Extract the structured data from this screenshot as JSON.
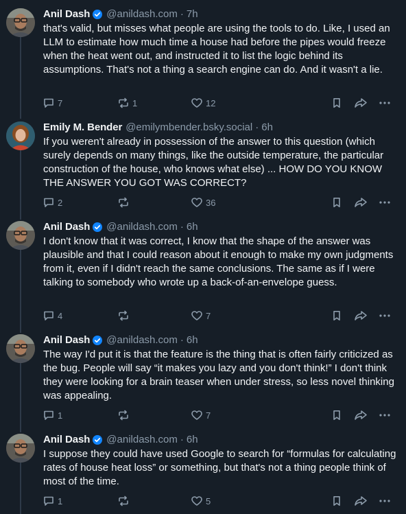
{
  "posts": [
    {
      "display_name": "Anil Dash",
      "verified": true,
      "handle": "@anildash.com",
      "separator": "·",
      "time": "7h",
      "text": "that's valid, but misses what people are using the tools to do. Like, I used an LLM to estimate how much time a house had before the pipes would freeze when the heat went out, and instructed it to list the logic behind its assumptions. That's not a thing a search engine can do. And it wasn't a lie.",
      "replies": "7",
      "reposts": "1",
      "likes": "12"
    },
    {
      "display_name": "Emily M. Bender",
      "verified": false,
      "handle": "@emilymbender.bsky.social",
      "separator": "·",
      "time": "6h",
      "text": "If you weren't already in possession of the answer to this question (which surely depends on many things, like the outside temperature, the particular construction of the house, who knows what else) ... HOW DO YOU KNOW THE ANSWER YOU GOT WAS CORRECT?",
      "replies": "2",
      "reposts": "",
      "likes": "36"
    },
    {
      "display_name": "Anil Dash",
      "verified": true,
      "handle": "@anildash.com",
      "separator": "·",
      "time": "6h",
      "text": "I don't know that it was correct, I know that the shape of the answer was plausible and that I could reason about it enough to make my own judgments from it, even if I didn't reach the same conclusions. The same as if I were talking to somebody who wrote up a back-of-an-envelope guess.",
      "replies": "4",
      "reposts": "",
      "likes": "7"
    },
    {
      "display_name": "Anil Dash",
      "verified": true,
      "handle": "@anildash.com",
      "separator": "·",
      "time": "6h",
      "text": "The way I'd put it is that the feature is the thing that is often fairly criticized as the bug. People will say “it makes you lazy and you don't think!” I don't think they were looking for a brain teaser when under stress, so less novel thinking was appealing.",
      "replies": "1",
      "reposts": "",
      "likes": "7"
    },
    {
      "display_name": "Anil Dash",
      "verified": true,
      "handle": "@anildash.com",
      "separator": "·",
      "time": "6h",
      "text": "I suppose they could have used Google to search for “formulas for calculating rates of house heat loss” or something, but that's not a thing people think of most of the time.",
      "replies": "1",
      "reposts": "",
      "likes": "5"
    }
  ],
  "icons": {
    "reply": "speech-bubble-icon",
    "repost": "repost-arrows-icon",
    "like": "heart-icon",
    "bookmark": "bookmark-icon",
    "share": "share-arrow-icon",
    "more": "ellipsis-icon",
    "verified": "verified-check-icon"
  },
  "colors": {
    "background": "#161e27",
    "text": "#f1f3f5",
    "muted": "#8c9baa",
    "verified": "#1185fe",
    "thread_line": "#2e3a48"
  }
}
